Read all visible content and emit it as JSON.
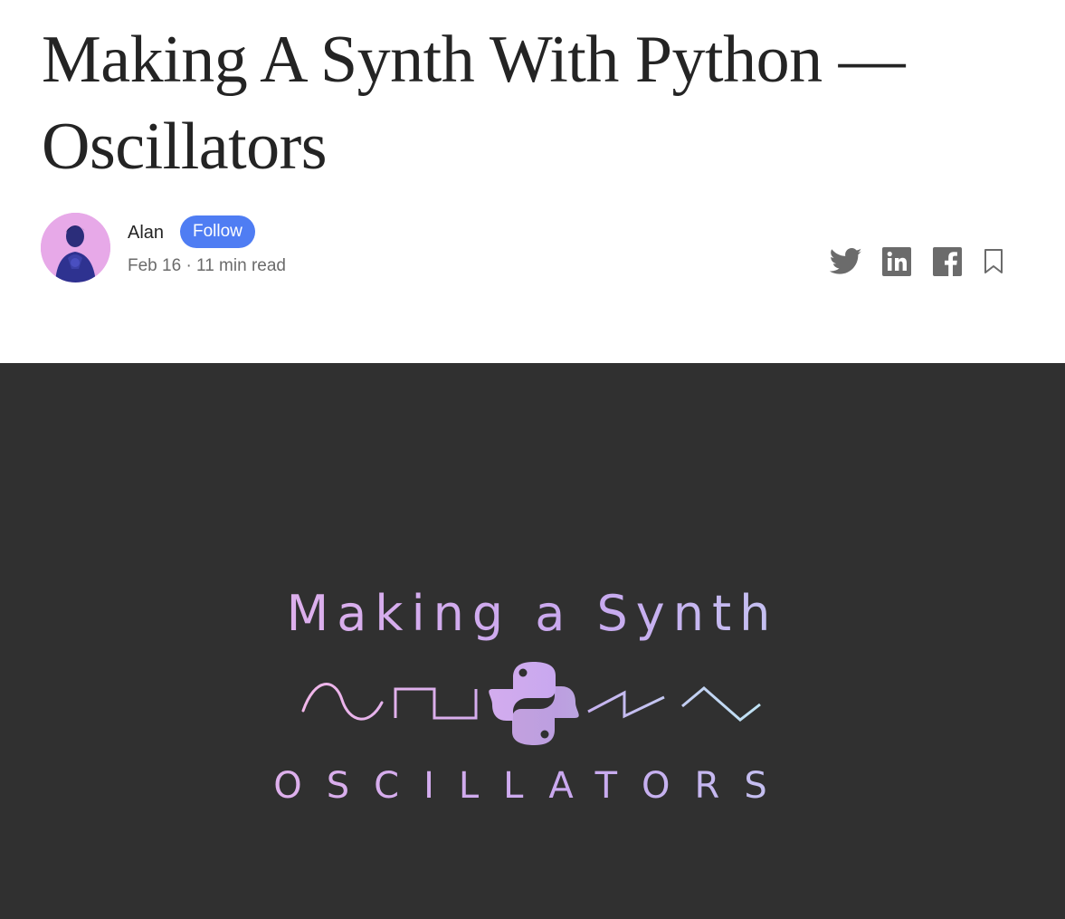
{
  "article": {
    "title": "Making A Synth With Python — Oscillators"
  },
  "author": {
    "name": "Alan",
    "follow_label": "Follow",
    "date": "Feb 16",
    "separator": "·",
    "read_time": "11 min read"
  },
  "share": {
    "icons": [
      "twitter-icon",
      "linkedin-icon",
      "facebook-icon",
      "bookmark-icon"
    ]
  },
  "hero": {
    "title": "Making a Synth",
    "subtitle": "OSCILLATORS",
    "waveforms": [
      "sine",
      "square",
      "python-logo",
      "sawtooth",
      "triangle"
    ]
  },
  "colors": {
    "title_text": "#242424",
    "meta_text": "#6b6b6b",
    "follow_bg": "#4f7df3",
    "hero_bg": "#303030",
    "gradient_start": "#f2b7ea",
    "gradient_mid": "#c8a8ef",
    "gradient_end": "#bfe6f4"
  }
}
